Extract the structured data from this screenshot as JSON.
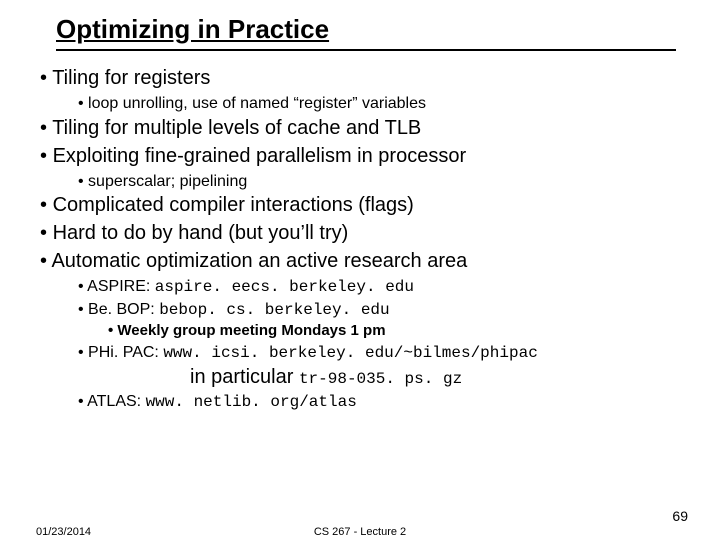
{
  "title": "Optimizing in Practice",
  "b1": "Tiling for registers",
  "b1s1": "loop unrolling, use of named “register” variables",
  "b2": "Tiling for multiple levels of cache and TLB",
  "b3": "Exploiting fine-grained parallelism in processor",
  "b3s1": "superscalar; pipelining",
  "b4": "Complicated compiler interactions (flags)",
  "b5": "Hard to do by hand (but you’ll try)",
  "b6": "Automatic optimization an active research area",
  "b6s1_pre": "ASPIRE: ",
  "b6s1_mono": "aspire. eecs. berkeley. edu",
  "b6s2_pre": "Be. BOP: ",
  "b6s2_mono": "bebop. cs. berkeley. edu",
  "b6s2s1": "Weekly group meeting Mondays 1 pm",
  "b6s3_pre": "PHi. PAC: ",
  "b6s3_mono": "www. icsi. berkeley. edu/~bilmes/phipac",
  "b6s3_cont_pre": "in particular ",
  "b6s3_cont_mono": "tr-98-035. ps. gz",
  "b6s4_pre": "ATLAS: ",
  "b6s4_mono": "www. netlib. org/atlas",
  "footer": {
    "date": "01/23/2014",
    "center": "CS 267 - Lecture 2",
    "num": "69"
  }
}
